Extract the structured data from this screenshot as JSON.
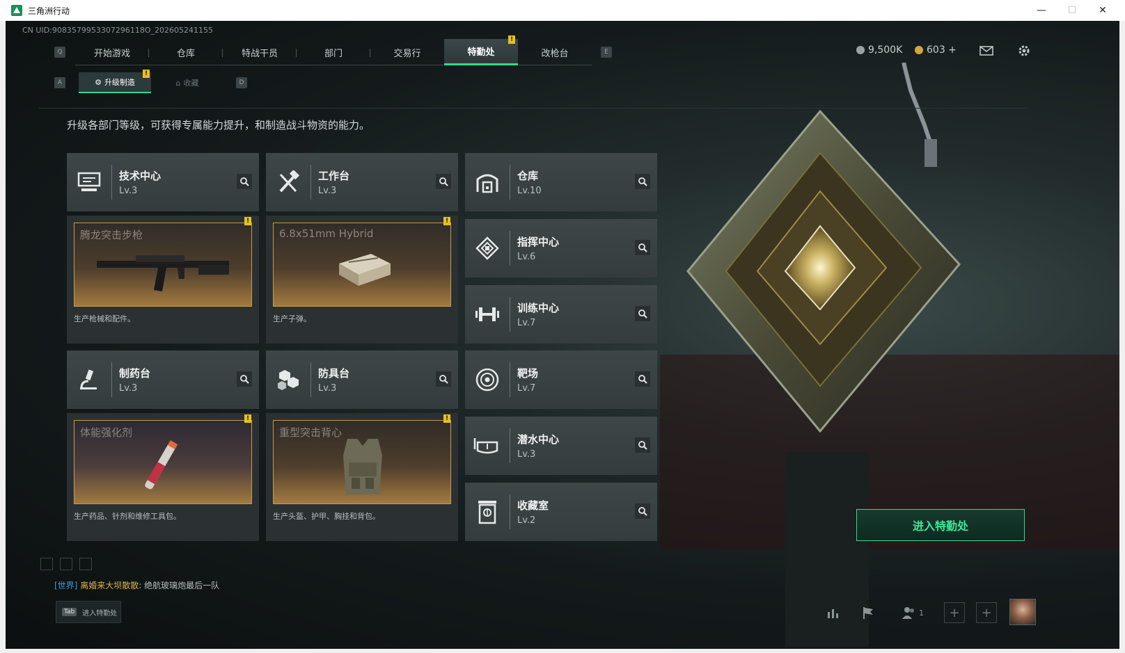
{
  "window": {
    "title": "三角洲行动",
    "minimize": "—",
    "maximize": "☐",
    "close": "✕"
  },
  "uid": "CN UID:9083579953307296118O_202605241155",
  "nav": {
    "left_key": "Q",
    "right_key": "E",
    "tabs": [
      "开始游戏",
      "仓库",
      "特战干员",
      "部门",
      "交易行",
      "特勤处",
      "改枪台"
    ],
    "active": "特勤处",
    "badge": "!"
  },
  "currency": {
    "silver": "9,500K",
    "gold": "603 +"
  },
  "subnav": {
    "left_key": "A",
    "right_key": "D",
    "tabs": [
      {
        "label": "升级制造",
        "active": true
      },
      {
        "label": "收藏",
        "active": false
      }
    ]
  },
  "description": "升级各部门等级，可获得专属能力提升，和制造战斗物资的能力。",
  "cards": [
    {
      "name": "技术中心",
      "level": "Lv.3",
      "icon": "computer-icon"
    },
    {
      "name": "工作台",
      "level": "Lv.3",
      "icon": "tools-icon"
    },
    {
      "name": "仓库",
      "level": "Lv.10",
      "icon": "warehouse-icon"
    },
    {
      "name": "指挥中心",
      "level": "Lv.6",
      "icon": "command-icon"
    },
    {
      "name": "训练中心",
      "level": "Lv.7",
      "icon": "dumbbell-icon"
    },
    {
      "name": "制药台",
      "level": "Lv.3",
      "icon": "microscope-icon"
    },
    {
      "name": "防具台",
      "level": "Lv.3",
      "icon": "armor-parts-icon"
    },
    {
      "name": "靶场",
      "level": "Lv.7",
      "icon": "target-icon"
    },
    {
      "name": "潜水中心",
      "level": "Lv.3",
      "icon": "diving-mask-icon"
    },
    {
      "name": "收藏室",
      "level": "Lv.2",
      "icon": "vault-icon"
    }
  ],
  "production": [
    {
      "item": "腾龙突击步枪",
      "desc": "生产枪械和配件。",
      "icon": "rifle-icon"
    },
    {
      "item": "6.8x51mm Hybrid",
      "desc": "生产子弹。",
      "icon": "ammo-box-icon"
    },
    {
      "item": "体能强化剂",
      "desc": "生产药品、针剂和维修工具包。",
      "icon": "syringe-icon"
    },
    {
      "item": "重型突击背心",
      "desc": "生产头盔、护甲、胸挂和背包。",
      "icon": "vest-icon"
    }
  ],
  "enter_button": "进入特勤处",
  "chat": {
    "channel": "[世界]",
    "user": "离婚来大坝散散",
    "message": "绝航玻璃炮最后一队"
  },
  "tab_hint": {
    "key": "Tab",
    "label": "进入特勤处"
  },
  "bottom": {
    "team_count": "1"
  },
  "colors": {
    "accent": "#2fdc8e",
    "badge": "#e8c020",
    "item_border": "#c99a4a"
  }
}
